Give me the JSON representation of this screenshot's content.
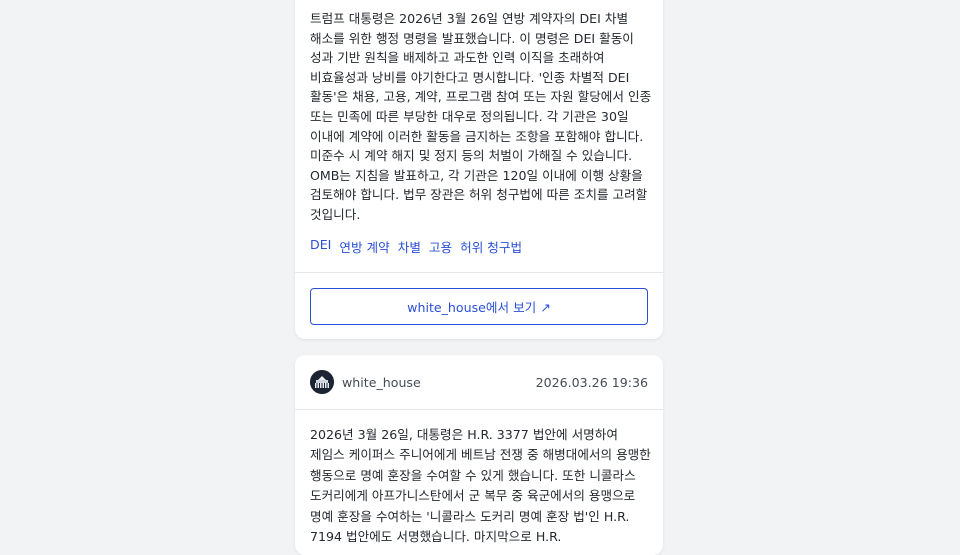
{
  "posts": [
    {
      "body": "트럼프 대통령은 2026년 3월 26일 연방 계약자의 DEI 차별 해소를 위한 행정 명령을 발표했습니다. 이 명령은 DEI 활동이 성과 기반 원칙을 배제하고 과도한 인력 이직을 초래하여 비효율성과 낭비를 야기한다고 명시합니다. '인종 차별적 DEI 활동'은 채용, 고용, 계약, 프로그램 참여 또는 자원 할당에서 인종 또는 민족에 따른 부당한 대우로 정의됩니다. 각 기관은 30일 이내에 계약에 이러한 활동을 금지하는 조항을 포함해야 합니다. 미준수 시 계약 해지 및 정지 등의 처벌이 가해질 수 있습니다. OMB는 지침을 발표하고, 각 기관은 120일 이내에 이행 상황을 검토해야 합니다. 법무 장관은 허위 청구법에 따른 조치를 고려할 것입니다.",
      "tags": [
        "DEI",
        "연방 계약",
        "차별",
        "고용",
        "허위 청구법"
      ],
      "view_button": "white_house에서 보기 ↗"
    },
    {
      "author": "white_house",
      "timestamp": "2026.03.26 19:36",
      "avatar_icon": "white-house-logo",
      "body": "2026년 3월 26일, 대통령은 H.R. 3377 법안에 서명하여 제임스 케이퍼스 주니어에게 베트남 전쟁 중 해병대에서의 용맹한 행동으로 명예 훈장을 수여할 수 있게 했습니다. 또한 니콜라스 도커리에게 아프가니스탄에서 군 복무 중 육군에서의 용맹으로 명예 훈장을 수여하는 '니콜라스 도커리 명예 훈장 법'인 H.R. 7194 법안에도 서명했습니다. 마지막으로 H.R."
    }
  ],
  "colors": {
    "link": "#2a4fd6",
    "background": "#f2f3f5",
    "card": "#ffffff"
  }
}
